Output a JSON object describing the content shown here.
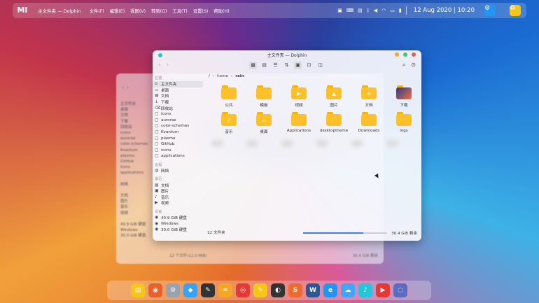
{
  "topbar": {
    "logo": "MI",
    "app_title": "主文件夹 — Dolphin",
    "menu": [
      "文件(F)",
      "编辑(E)",
      "视图(V)",
      "转到(G)",
      "工具(T)",
      "设置(S)",
      "帮助(H)"
    ],
    "clock": "12 Aug 2020 | 10:20",
    "tray_icons": [
      "calendar-icon",
      "keyboard-icon",
      "bluetooth-icon",
      "volume-icon",
      "wifi-icon",
      "display-icon",
      "battery-icon",
      "clipboard-icon"
    ],
    "settings_color": "#2196f3",
    "trash_color": "#f5c518"
  },
  "back_window": {
    "sidebar": [
      "主文件夹",
      "桌面",
      "文档",
      "下载",
      "回收站",
      "icons",
      "aurorae",
      "color-schemes",
      "Kvantum",
      "plasma",
      "GitHub",
      "icons",
      "applications",
      "",
      "网络",
      "",
      "文档",
      "图片",
      "音乐",
      "视频",
      "",
      "40.9 GiB 硬盘",
      "Windows",
      "30.0 GiB 硬盘"
    ],
    "status": "12 个文件(12.0 MiB)",
    "free": "30.4 GiB 剩余"
  },
  "window": {
    "title": "主文件夹 — Dolphin",
    "breadcrumb": [
      "/",
      "home",
      "rain"
    ],
    "sidebar_groups": {
      "places": "位置",
      "remote": "远程",
      "recent": "最近",
      "devices": "设备"
    },
    "places": [
      "主文件夹",
      "桌面",
      "文档",
      "下载",
      "回收站",
      "icons",
      "aurorae",
      "color-schemes",
      "Kvantum",
      "plasma",
      "GitHub",
      "icons",
      "applications"
    ],
    "remote": [
      "网络"
    ],
    "recent": [
      "文档",
      "图片",
      "音乐",
      "视频"
    ],
    "devices": [
      "40.9 GiB 硬盘",
      "Windows",
      "30.0 GiB 硬盘"
    ],
    "files": [
      {
        "name": "公共",
        "icon": "folder-icon"
      },
      {
        "name": "模板",
        "icon": "folder-icon"
      },
      {
        "name": "视频",
        "icon": "folder-video-icon"
      },
      {
        "name": "图片",
        "icon": "folder-pictures-icon"
      },
      {
        "name": "文档",
        "icon": "folder-documents-icon"
      },
      {
        "name": "下载",
        "icon": "folder-downloads-icon"
      },
      {
        "name": "音乐",
        "icon": "folder-music-icon"
      },
      {
        "name": "桌面",
        "icon": "folder-desktop-icon"
      },
      {
        "name": "Applications",
        "icon": "folder-icon"
      },
      {
        "name": "desktoptheme",
        "icon": "folder-icon"
      },
      {
        "name": "Downloads",
        "icon": "folder-icon"
      },
      {
        "name": "logs",
        "icon": "folder-icon"
      }
    ],
    "status": "12 文件夹",
    "free": "30.4 GiB 剩余",
    "disk_used_fraction": 0.72
  },
  "dock": [
    "files",
    "firefox",
    "settings",
    "qq",
    "inkscape",
    "calculator",
    "netease-music",
    "notes",
    "github",
    "shop",
    "wps-word",
    "browser",
    "cloud",
    "music",
    "video",
    "clean"
  ]
}
